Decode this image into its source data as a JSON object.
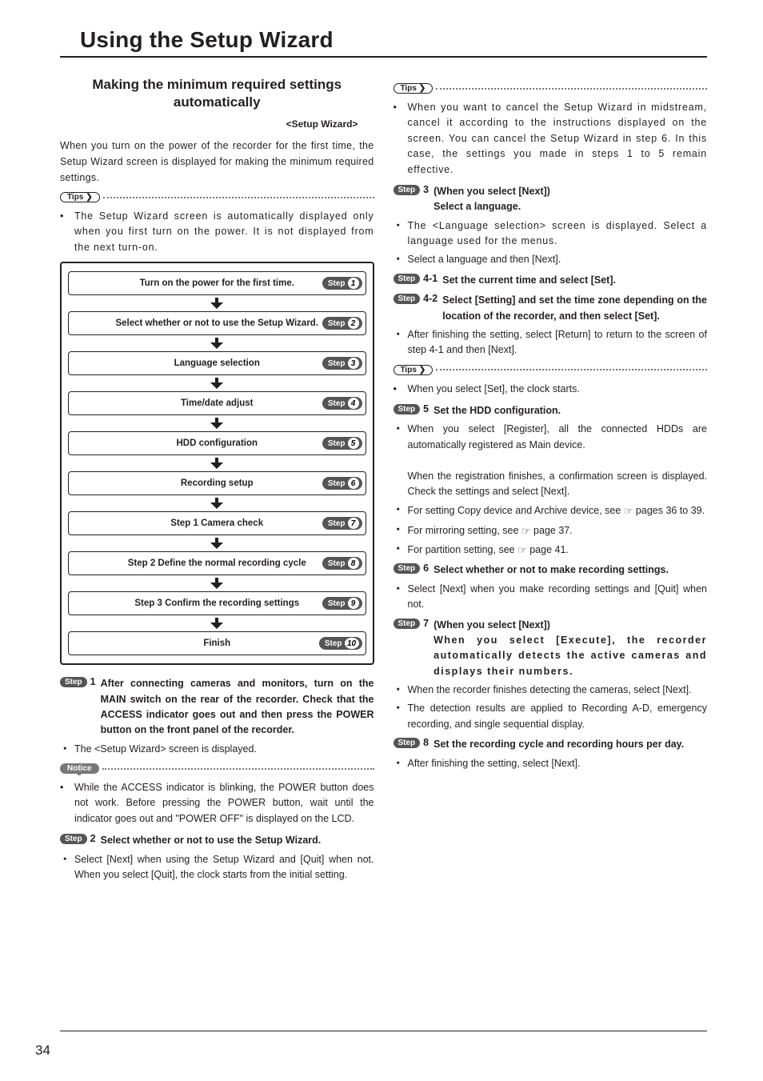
{
  "page_title": "Using the Setup Wizard",
  "page_number": "34",
  "left": {
    "section_head_l1": "Making the minimum required settings",
    "section_head_l2": "automatically",
    "wizard_tag": "<Setup Wizard>",
    "intro": "When you turn on the power of the recorder for the first time, the Setup Wizard screen is displayed for making the minimum required settings.",
    "tips1_label": "Tips",
    "tip1_text": "The Setup Wizard screen is automatically displayed only when you first turn on the power. It is not displayed from the next turn-on.",
    "flow": [
      {
        "label": "Turn on the power for the first time.",
        "step": "1"
      },
      {
        "label": "Select whether or not to use the Setup Wizard.",
        "step": "2"
      },
      {
        "label": "Language selection",
        "step": "3"
      },
      {
        "label": "Time/date adjust",
        "step": "4"
      },
      {
        "label": "HDD configuration",
        "step": "5"
      },
      {
        "label": "Recording setup",
        "step": "6"
      },
      {
        "label": "Step 1  Camera check",
        "step": "7"
      },
      {
        "label": "Step 2  Define the normal recording cycle",
        "step": "8"
      },
      {
        "label": "Step 3  Confirm the recording settings",
        "step": "9"
      },
      {
        "label": "Finish",
        "step": "10"
      }
    ],
    "step_badge_label": "Step",
    "step1_title": "After connecting cameras and monitors, turn on the MAIN switch on the rear of the recorder. Check that the ACCESS indicator goes out and then press the POWER button on the front panel of the recorder.",
    "step1_sub": "The <Setup Wizard> screen is displayed.",
    "notice_label": "Notice",
    "notice_text": "While the ACCESS indicator is blinking, the POWER button does not work. Before pressing the POWER button, wait until the indicator goes out and \"POWER OFF\" is displayed on the LCD.",
    "step2_title": "Select whether or not to use the Setup Wizard.",
    "step2_sub": "Select [Next] when using the Setup Wizard and [Quit] when not. When you select [Quit], the clock starts from the initial setting."
  },
  "right": {
    "tips2_label": "Tips",
    "tip2_text": "When you want to cancel the Setup Wizard in midstream, cancel it according to the instructions displayed on the screen. You can cancel the Setup Wizard in step 6. In this case, the settings you made in steps 1 to 5 remain effective.",
    "step3_title_l1": "(When you select [Next])",
    "step3_title_l2": "Select a language.",
    "step3_sub1": "The <Language selection> screen is displayed. Select a language used for the menus.",
    "step3_sub2": "Select a language and then [Next].",
    "step4_1_num": "4-1",
    "step4_1_title": "Set the current time and select [Set].",
    "step4_2_num": "4-2",
    "step4_2_title": "Select [Setting] and set the time zone depending on the location of the recorder, and then select [Set].",
    "step4_2_sub": "After finishing the setting, select [Return] to return to the screen of step 4-1 and then [Next].",
    "tips3_label": "Tips",
    "tip3_text": "When you select [Set], the clock starts.",
    "step5_title": "Set the HDD configuration.",
    "step5_sub1a": "When you select [Register], all the connected HDDs are automatically registered as Main device.",
    "step5_sub1b": "When the registration finishes, a confirmation screen is displayed. Check the settings and select [Next].",
    "step5_sub2_pre": "For setting Copy device and Archive device, see ",
    "step5_sub2_post": " pages 36 to 39.",
    "step5_sub3_pre": "For mirroring setting, see ",
    "step5_sub3_post": " page 37.",
    "step5_sub4_pre": "For partition setting, see ",
    "step5_sub4_post": " page 41.",
    "step6_title": "Select whether or not to make recording settings.",
    "step6_sub": "Select [Next] when you make recording settings and [Quit] when not.",
    "step7_title_l1": "(When you select [Next])",
    "step7_title_l2": "When you select [Execute], the recorder automatically detects the active cameras and displays their numbers.",
    "step7_sub1": "When the recorder finishes detecting the cameras, select [Next].",
    "step7_sub2": "The detection results are applied to Recording A-D, emergency recording, and single sequential display.",
    "step8_title": "Set the recording cycle and recording hours per day.",
    "step8_sub": "After finishing the setting, select [Next]."
  }
}
